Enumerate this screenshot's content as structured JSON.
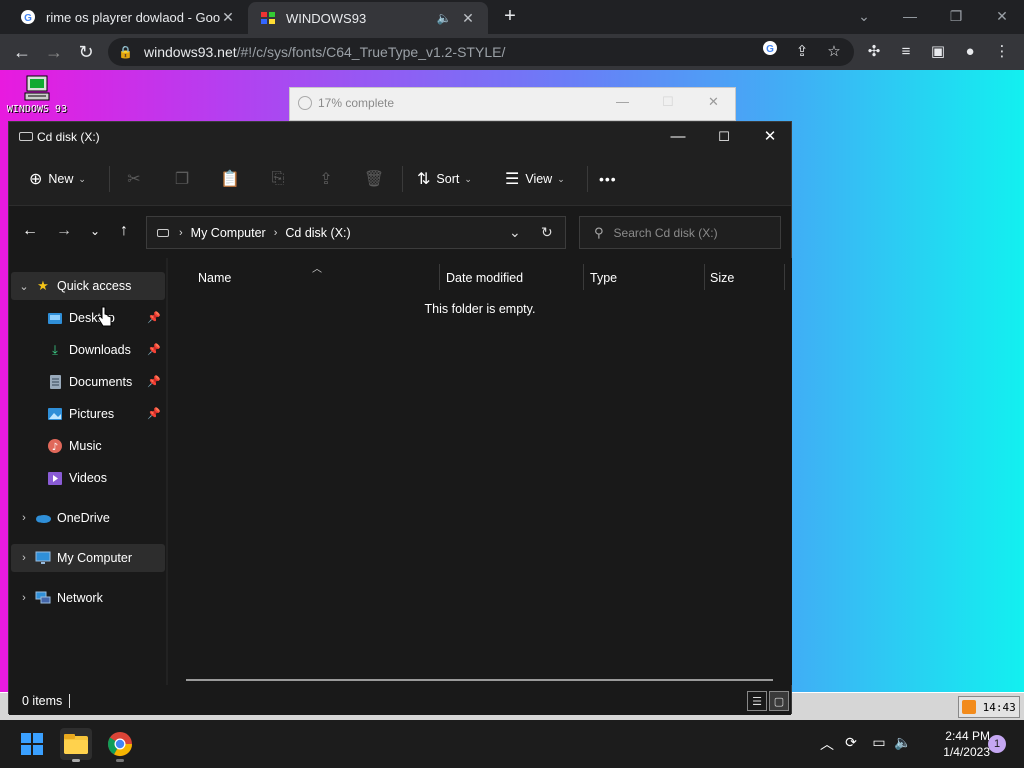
{
  "browser": {
    "tabs": [
      {
        "title": "rime os playrer dowlaod - Google",
        "favicon": "google-g-icon"
      },
      {
        "title": "WINDOWS93",
        "favicon": "windows93-icon",
        "audio": "speaker-icon"
      }
    ],
    "new_tab": "+",
    "address": {
      "host": "windows93.net",
      "path": "/#!/c/sys/fonts/C64_TrueType_v1.2-STYLE/"
    }
  },
  "desktop": {
    "icon_label": "WINDOWS 93",
    "progress_text": "17% complete",
    "w93_clock": "14:43"
  },
  "explorer": {
    "title": "Cd disk (X:)",
    "toolbar": {
      "new": "New",
      "sort": "Sort",
      "view": "View",
      "more": "•••"
    },
    "breadcrumb": [
      "My Computer",
      "Cd disk (X:)"
    ],
    "search_placeholder": "Search Cd disk (X:)",
    "nav": {
      "quick_access": "Quick access",
      "desktop": "Desktop",
      "downloads": "Downloads",
      "documents": "Documents",
      "pictures": "Pictures",
      "music": "Music",
      "videos": "Videos",
      "onedrive": "OneDrive",
      "my_computer": "My Computer",
      "network": "Network"
    },
    "columns": {
      "name": "Name",
      "date": "Date modified",
      "type": "Type",
      "size": "Size"
    },
    "empty_message": "This folder is empty.",
    "status": "0 items"
  },
  "taskbar": {
    "time": "2:44 PM",
    "date": "1/4/2023",
    "notifications": "1"
  }
}
